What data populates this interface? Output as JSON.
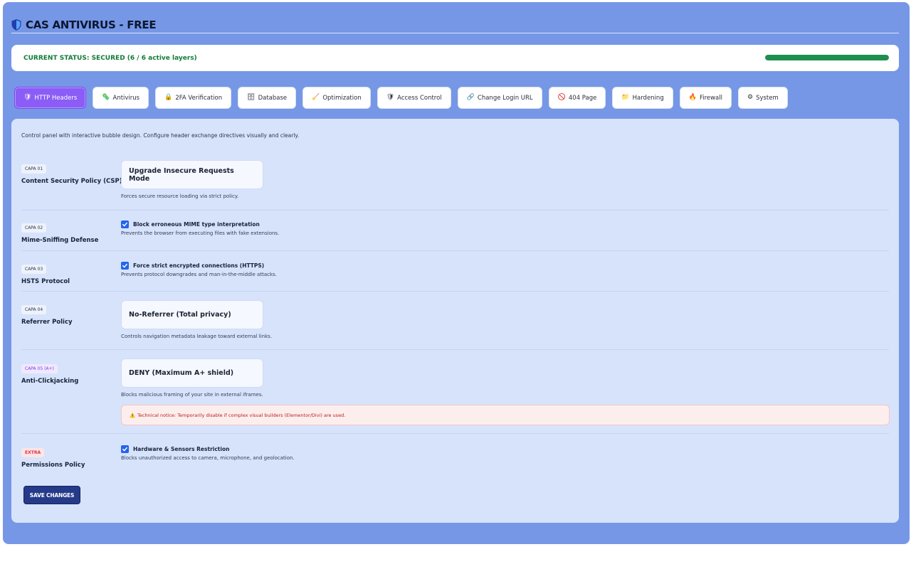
{
  "app": {
    "title": "CAS ANTIVIRUS - FREE",
    "title_icon": "shield-icon"
  },
  "status": {
    "text": "CURRENT STATUS: SECURED (6 / 6 active layers)",
    "progress_fraction": 1.0,
    "color": "#1f8f50"
  },
  "tabs": [
    {
      "label": "HTTP Headers",
      "icon": "shield-icon",
      "glyph": "🛡",
      "active": true
    },
    {
      "label": "Antivirus",
      "icon": "bug-icon",
      "glyph": "🦠",
      "active": false
    },
    {
      "label": "2FA Verification",
      "icon": "lock-icon",
      "glyph": "🔒",
      "active": false
    },
    {
      "label": "Database",
      "icon": "database-icon",
      "glyph": "🗄",
      "active": false
    },
    {
      "label": "Optimization",
      "icon": "broom-icon",
      "glyph": "🧹",
      "active": false
    },
    {
      "label": "Access Control",
      "icon": "shield-icon",
      "glyph": "🛡",
      "active": false
    },
    {
      "label": "Change Login URL",
      "icon": "link-icon",
      "glyph": "🔗",
      "active": false
    },
    {
      "label": "404 Page",
      "icon": "prohibited-icon",
      "glyph": "🚫",
      "active": false
    },
    {
      "label": "Hardening",
      "icon": "folder-icon",
      "glyph": "📁",
      "active": false
    },
    {
      "label": "Firewall",
      "icon": "fire-icon",
      "glyph": "🔥",
      "active": false
    },
    {
      "label": "System",
      "icon": "gear-icon",
      "glyph": "⚙",
      "active": false
    }
  ],
  "panel": {
    "intro": "Control panel with interactive bubble design. Configure header exchange directives visually and clearly.",
    "rows": [
      {
        "badge": "CAPA 01",
        "title": "Content Security Policy (CSP)",
        "control": "select",
        "value": "Upgrade Insecure Requests Mode",
        "help": "Forces secure resource loading via strict policy."
      },
      {
        "badge": "CAPA 02",
        "title": "Mime-Sniffing Defense",
        "control": "checkbox",
        "checked": true,
        "value": "Block erroneous MIME type interpretation",
        "help": "Prevents the browser from executing files with fake extensions."
      },
      {
        "badge": "CAPA 03",
        "title": "HSTS Protocol",
        "control": "checkbox",
        "checked": true,
        "value": "Force strict encrypted connections (HTTPS)",
        "help": "Prevents protocol downgrades and man-in-the-middle attacks."
      },
      {
        "badge": "CAPA 04",
        "title": "Referrer Policy",
        "control": "select",
        "value": "No-Referrer (Total privacy)",
        "help": "Controls navigation metadata leakage toward external links."
      },
      {
        "badge": "CAPA 05 (A+)",
        "title": "Anti-Clickjacking",
        "control": "select",
        "value": "DENY (Maximum A+ shield)",
        "help": "Blocks malicious framing of your site in external iframes.",
        "notice": "Technical notice: Temporarily disable if complex visual builders (Elementor/Divi) are used.",
        "notice_icon": "warning-icon"
      },
      {
        "badge": "EXTRA",
        "title": "Permissions Policy",
        "control": "checkbox",
        "checked": true,
        "value": "Hardware & Sensors Restriction",
        "help": "Blocks unauthorized access to camera, microphone, and geolocation."
      }
    ],
    "save_label": "SAVE CHANGES"
  }
}
